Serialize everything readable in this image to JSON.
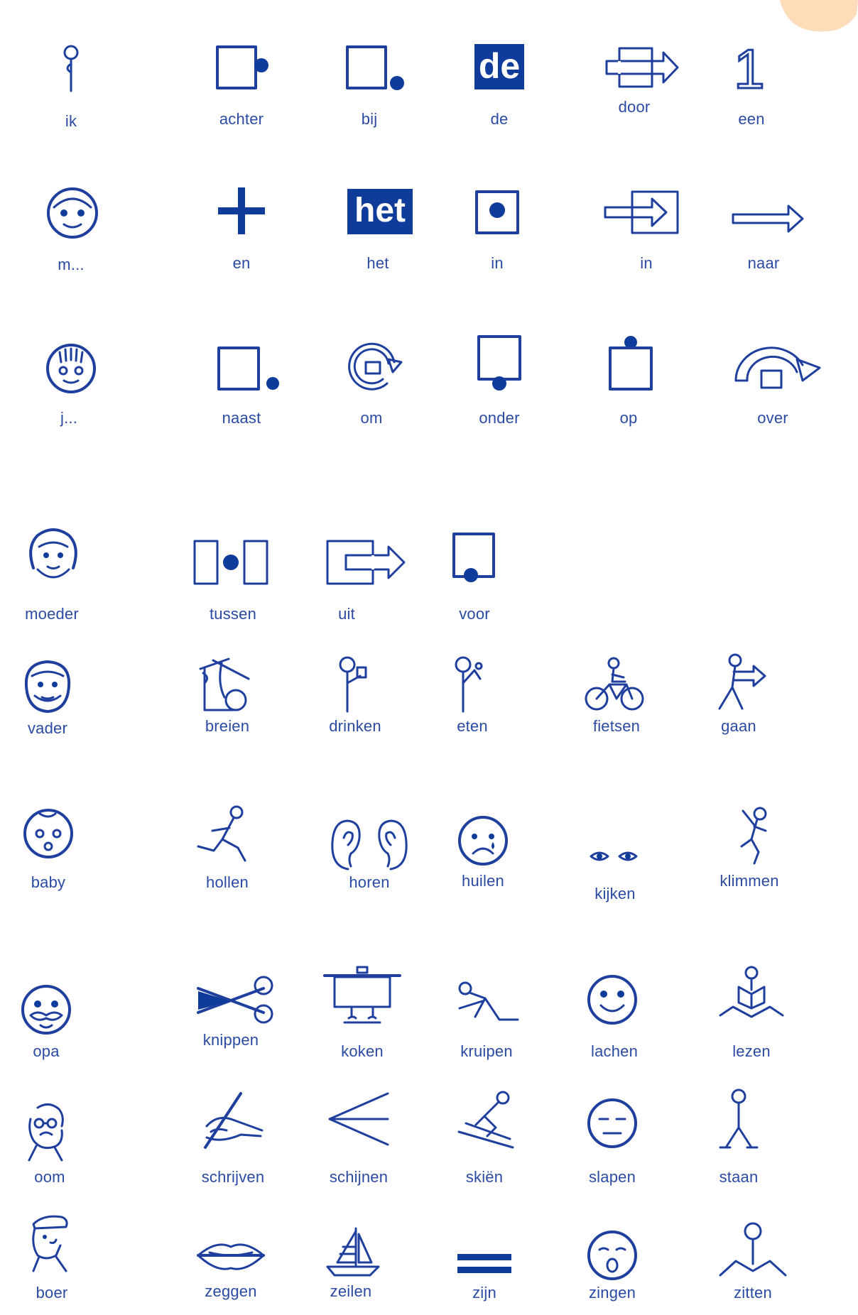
{
  "row1": [
    "ik",
    "achter",
    "bij",
    "de",
    "door",
    "een"
  ],
  "row2": [
    "m...",
    "en",
    "het",
    "in",
    "in",
    "naar"
  ],
  "row3": [
    "j...",
    "naast",
    "om",
    "onder",
    "op",
    "over"
  ],
  "row4": [
    "moeder",
    "tussen",
    "uit",
    "voor"
  ],
  "row5": [
    "vader",
    "breien",
    "drinken",
    "eten",
    "fietsen",
    "gaan"
  ],
  "row6": [
    "baby",
    "hollen",
    "horen",
    "huilen",
    "kijken",
    "klimmen"
  ],
  "row7": [
    "opa",
    "knippen",
    "koken",
    "kruipen",
    "lachen",
    "lezen"
  ],
  "row8": [
    "oom",
    "schrijven",
    "schijnen",
    "skiën",
    "slapen",
    "staan"
  ],
  "row9": [
    "boer",
    "zeggen",
    "zeilen",
    "zijn",
    "zingen",
    "zitten"
  ],
  "tiles": {
    "de": "de",
    "het": "het",
    "een": "1"
  },
  "colors": {
    "symbol": "#1f3f9e",
    "label": "#2b4aa3",
    "accent": "#f6a24a"
  }
}
